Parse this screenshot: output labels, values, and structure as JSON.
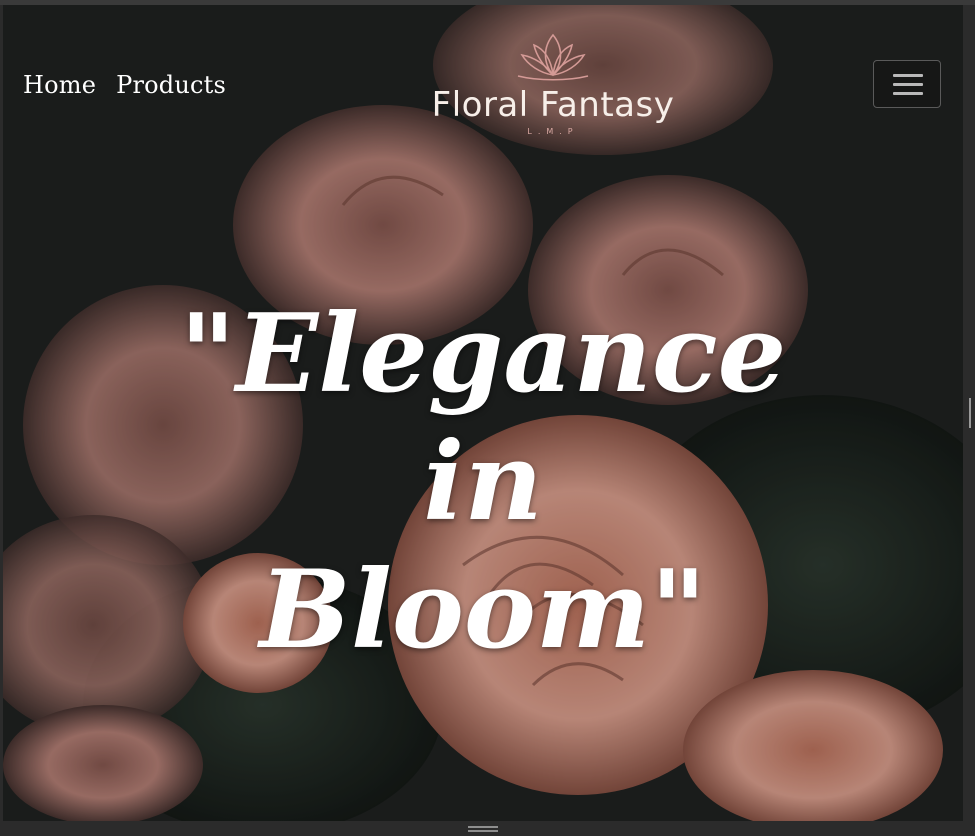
{
  "nav": {
    "items": [
      {
        "label": "Home"
      },
      {
        "label": "Products"
      }
    ]
  },
  "brand": {
    "name": "Floral Fantasy",
    "sub": "L.M.P",
    "logo_icon": "lotus-icon",
    "accent": "#d49a96"
  },
  "hero": {
    "headline_line1": "\"Elegance in",
    "headline_line2": "Bloom\""
  },
  "menu": {
    "icon": "hamburger-menu-icon"
  }
}
